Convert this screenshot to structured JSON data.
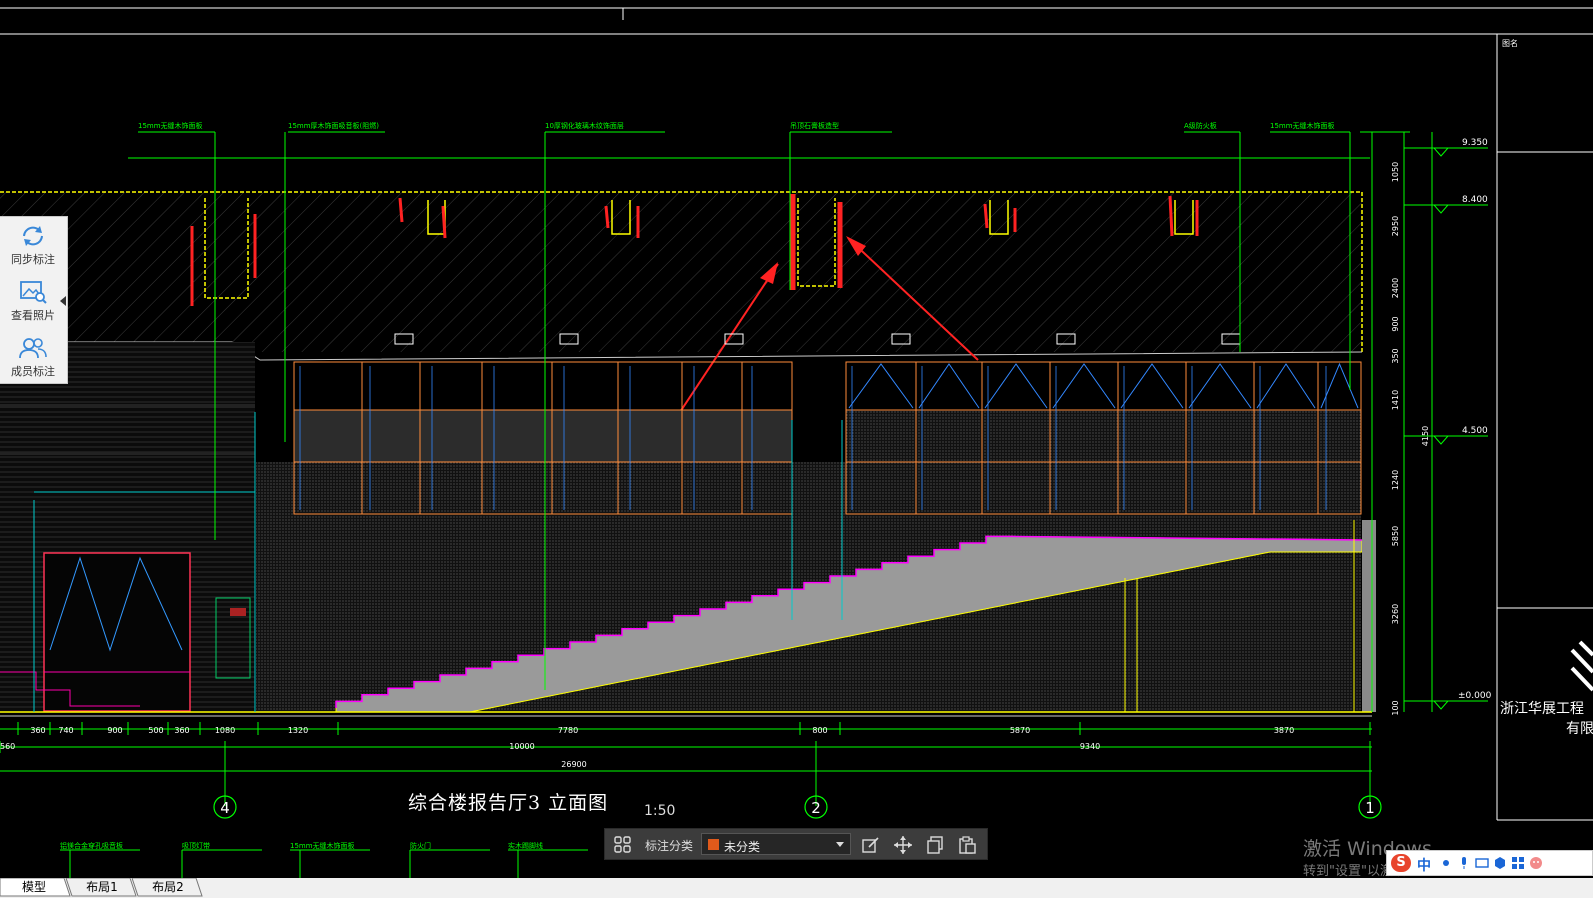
{
  "drawing": {
    "title": "综合楼报告厅3 立面图",
    "scale": "1:50",
    "company_line1": "浙江华展工程",
    "company_line2": "有限",
    "top_right_label": "图名",
    "notes": [
      "15mm无缝木饰面板",
      "15mm厚木饰面吸音板(阻燃)",
      "10厚钢化玻璃木纹饰面层",
      "吊顶石膏板造型",
      "A级防火板",
      "15mm无缝木饰面板"
    ],
    "bottom_notes": [
      "铝镁合金穿孔吸音板",
      "吸顶灯带",
      "15mm无缝木饰面板",
      "防火门",
      "实木踢脚线"
    ],
    "dims_bottom": [
      "360",
      "740",
      "900",
      "500",
      "360",
      "1080",
      "1320",
      "7780",
      "800",
      "5870",
      "3870"
    ],
    "dims_total_1": "10000",
    "dims_total_2": "9340",
    "dims_total_3": "26900",
    "dim_left": "560",
    "dims_right": [
      "1050",
      "2950",
      "2400",
      "900",
      "350",
      "1410",
      "4150",
      "1240",
      "5850",
      "3260",
      "100"
    ],
    "levels": [
      "9.350",
      "8.400",
      "4.500",
      "±0.000"
    ],
    "axis_labels": [
      "4",
      "2",
      "1"
    ]
  },
  "side_toolbar": {
    "items": [
      {
        "label": "同步标注"
      },
      {
        "label": "查看照片"
      },
      {
        "label": "成员标注"
      }
    ]
  },
  "annotation_bar": {
    "category_label": "标注分类",
    "category_value": "未分类",
    "category_color": "#e05a1b"
  },
  "tabs": [
    {
      "label": "模型"
    },
    {
      "label": "布局1"
    },
    {
      "label": "布局2"
    }
  ],
  "watermark": {
    "line1": "激活 Windows",
    "line2": "转到\"设置\"以激活 Windows。"
  },
  "ime": {
    "brand": "S",
    "mode": "中"
  },
  "colors": {
    "dim_green": "#00ff00",
    "outline_yellow": "#ffff00",
    "frame_orange": "#ff8c3a",
    "markup_red": "#ff2222",
    "guide_cyan": "#00cccc"
  }
}
